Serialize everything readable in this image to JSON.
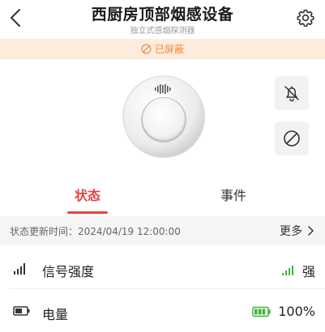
{
  "header": {
    "title": "西厨房顶部烟感设备",
    "subtitle": "独立式感烟探测器"
  },
  "banner": {
    "text": "已屏蔽",
    "color": "#f08a3c"
  },
  "icons": {
    "back": "chevron-left-icon",
    "settings": "gear-icon",
    "mute": "bell-off-icon",
    "block": "block-icon",
    "device": "smoke-detector-icon",
    "signal": "signal-bars-icon",
    "battery": "battery-icon"
  },
  "tabs": [
    {
      "label": "状态",
      "active": true
    },
    {
      "label": "事件",
      "active": false
    }
  ],
  "status": {
    "update_label": "状态更新时间：2024/04/19 12:00:00",
    "more_label": "更多"
  },
  "rows": {
    "signal": {
      "label": "信号强度",
      "value": "强",
      "color": "#3db83b"
    },
    "battery": {
      "label": "电量",
      "value": "100%",
      "level": 1.0,
      "color": "#3db83b"
    }
  },
  "accent": "#e64340"
}
